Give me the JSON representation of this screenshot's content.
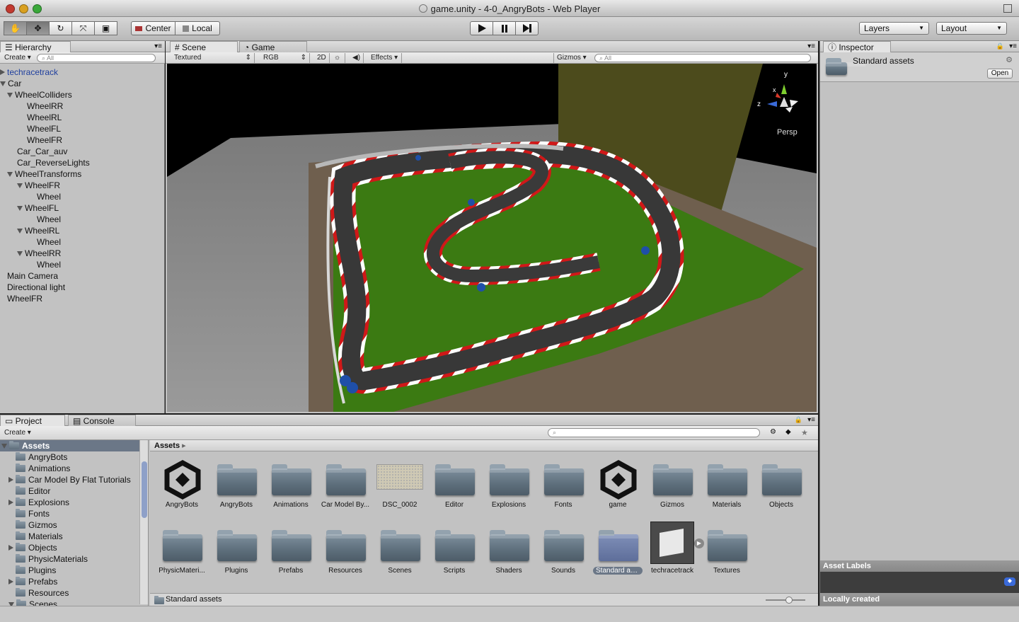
{
  "window": {
    "title": "game.unity - 4-0_AngryBots - Web Player"
  },
  "toolbar": {
    "center_label": "Center",
    "local_label": "Local",
    "layers_label": "Layers",
    "layout_label": "Layout"
  },
  "hierarchy": {
    "tab": "Hierarchy",
    "create": "Create",
    "search_placeholder": "All",
    "items": [
      {
        "label": "techracetrack",
        "depth": 0,
        "toggle": "collapsed",
        "prefab": true
      },
      {
        "label": "Car",
        "depth": 0,
        "toggle": "expanded"
      },
      {
        "label": "WheelColliders",
        "depth": 1,
        "toggle": "expanded"
      },
      {
        "label": "WheelRR",
        "depth": 2,
        "toggle": "none"
      },
      {
        "label": "WheelRL",
        "depth": 2,
        "toggle": "none"
      },
      {
        "label": "WheelFL",
        "depth": 2,
        "toggle": "none"
      },
      {
        "label": "WheelFR",
        "depth": 2,
        "toggle": "none"
      },
      {
        "label": "Car_Car_auv",
        "depth": 1,
        "toggle": "none"
      },
      {
        "label": "Car_ReverseLights",
        "depth": 1,
        "toggle": "none"
      },
      {
        "label": "WheelTransforms",
        "depth": 1,
        "toggle": "expanded"
      },
      {
        "label": "WheelFR",
        "depth": 2,
        "toggle": "expanded"
      },
      {
        "label": "Wheel",
        "depth": 3,
        "toggle": "none"
      },
      {
        "label": "WheelFL",
        "depth": 2,
        "toggle": "expanded"
      },
      {
        "label": "Wheel",
        "depth": 3,
        "toggle": "none"
      },
      {
        "label": "WheelRL",
        "depth": 2,
        "toggle": "expanded"
      },
      {
        "label": "Wheel",
        "depth": 3,
        "toggle": "none"
      },
      {
        "label": "WheelRR",
        "depth": 2,
        "toggle": "expanded"
      },
      {
        "label": "Wheel",
        "depth": 3,
        "toggle": "none"
      },
      {
        "label": "Main Camera",
        "depth": 0,
        "toggle": "none"
      },
      {
        "label": "Directional light",
        "depth": 0,
        "toggle": "none"
      },
      {
        "label": "WheelFR",
        "depth": 0,
        "toggle": "none"
      }
    ]
  },
  "scene": {
    "tab_scene": "Scene",
    "tab_game": "Game",
    "render_mode": "Textured",
    "color_mode": "RGB",
    "mode_2d": "2D",
    "effects": "Effects",
    "gizmos": "Gizmos",
    "search_placeholder": "All",
    "persp": "Persp",
    "axis_y": "y",
    "axis_z": "z",
    "axis_x": "x"
  },
  "inspector": {
    "tab": "Inspector",
    "title": "Standard assets",
    "open_button": "Open",
    "asset_labels": "Asset Labels",
    "footer": "Locally created"
  },
  "project": {
    "tab_project": "Project",
    "tab_console": "Console",
    "create": "Create",
    "breadcrumb": "Assets",
    "footer_path": "Standard assets",
    "tree": [
      {
        "label": "Assets",
        "depth": 0,
        "toggle": "expanded",
        "selected": true
      },
      {
        "label": "AngryBots",
        "depth": 1,
        "toggle": "none"
      },
      {
        "label": "Animations",
        "depth": 1,
        "toggle": "none"
      },
      {
        "label": "Car Model By Flat Tutorials",
        "depth": 1,
        "toggle": "collapsed"
      },
      {
        "label": "Editor",
        "depth": 1,
        "toggle": "none"
      },
      {
        "label": "Explosions",
        "depth": 1,
        "toggle": "collapsed"
      },
      {
        "label": "Fonts",
        "depth": 1,
        "toggle": "none"
      },
      {
        "label": "Gizmos",
        "depth": 1,
        "toggle": "none"
      },
      {
        "label": "Materials",
        "depth": 1,
        "toggle": "none"
      },
      {
        "label": "Objects",
        "depth": 1,
        "toggle": "collapsed"
      },
      {
        "label": "PhysicMaterials",
        "depth": 1,
        "toggle": "none"
      },
      {
        "label": "Plugins",
        "depth": 1,
        "toggle": "none"
      },
      {
        "label": "Prefabs",
        "depth": 1,
        "toggle": "collapsed"
      },
      {
        "label": "Resources",
        "depth": 1,
        "toggle": "none"
      },
      {
        "label": "Scenes",
        "depth": 1,
        "toggle": "expanded"
      }
    ],
    "assets": [
      {
        "label": "AngryBots",
        "kind": "unity"
      },
      {
        "label": "AngryBots",
        "kind": "folder"
      },
      {
        "label": "Animations",
        "kind": "folder"
      },
      {
        "label": "Car Model By...",
        "kind": "folder"
      },
      {
        "label": "DSC_0002",
        "kind": "texture"
      },
      {
        "label": "Editor",
        "kind": "folder"
      },
      {
        "label": "Explosions",
        "kind": "folder"
      },
      {
        "label": "Fonts",
        "kind": "folder"
      },
      {
        "label": "game",
        "kind": "unity"
      },
      {
        "label": "Gizmos",
        "kind": "folder"
      },
      {
        "label": "Materials",
        "kind": "folder"
      },
      {
        "label": "Objects",
        "kind": "folder"
      },
      {
        "label": "PhysicMateri...",
        "kind": "folder"
      },
      {
        "label": "Plugins",
        "kind": "folder"
      },
      {
        "label": "Prefabs",
        "kind": "folder"
      },
      {
        "label": "Resources",
        "kind": "folder"
      },
      {
        "label": "Scenes",
        "kind": "folder"
      },
      {
        "label": "Scripts",
        "kind": "folder"
      },
      {
        "label": "Shaders",
        "kind": "folder"
      },
      {
        "label": "Sounds",
        "kind": "folder"
      },
      {
        "label": "Standard ass...",
        "kind": "folder",
        "selected": true
      },
      {
        "label": "techracetrack",
        "kind": "model"
      },
      {
        "label": "Textures",
        "kind": "folder"
      }
    ]
  },
  "colors": {
    "panel_bg": "#c2c2c2",
    "selection": "#6b7787",
    "prefab_text": "#1f3f9e",
    "grass": "#3b7a12",
    "asphalt": "#3a3a3a",
    "curb_red": "#d01818",
    "ground": "#6f5f4e"
  }
}
